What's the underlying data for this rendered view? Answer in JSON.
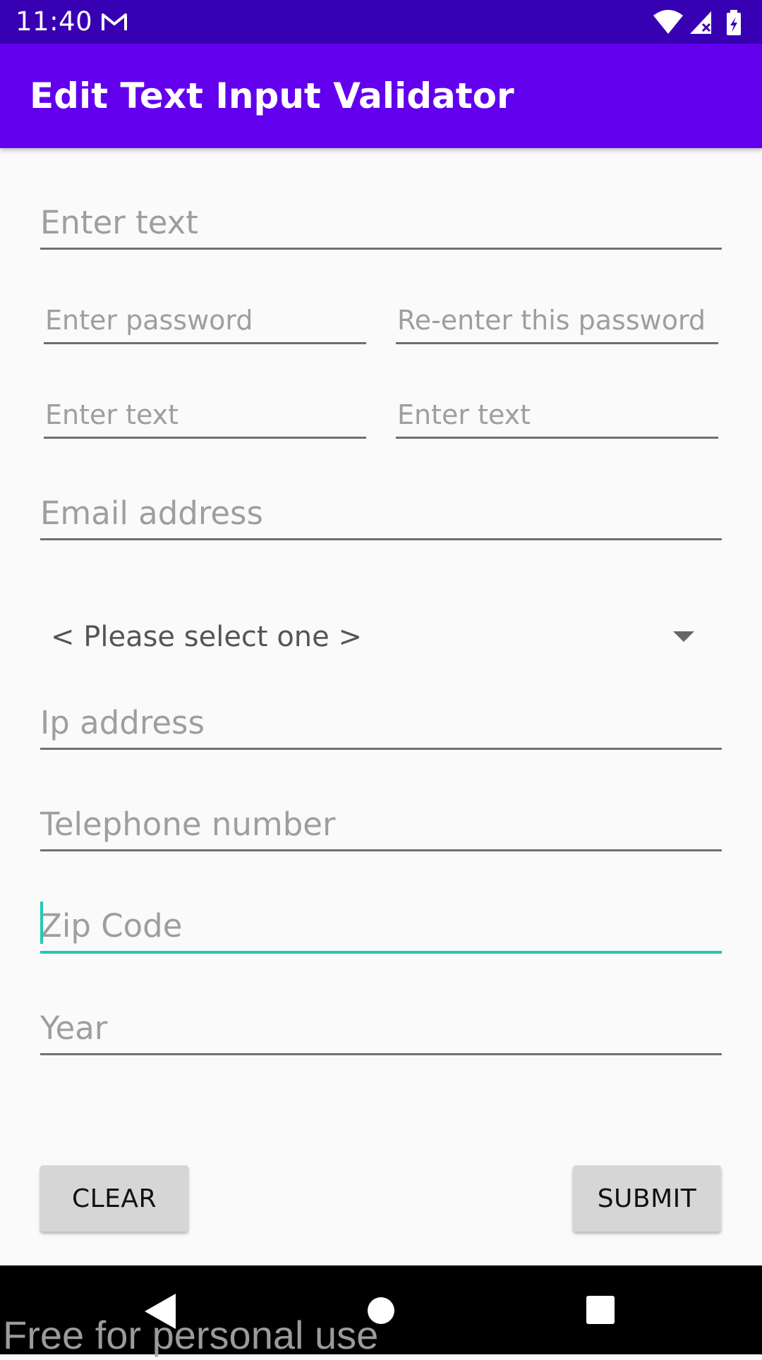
{
  "status_bar": {
    "time": "11:40",
    "icons": [
      "gmail-icon",
      "wifi-icon",
      "signal-icon",
      "battery-charging-icon"
    ]
  },
  "app_bar": {
    "title": "Edit Text Input Validator"
  },
  "form": {
    "text_field": {
      "placeholder": "Enter text",
      "value": ""
    },
    "password_field": {
      "placeholder": "Enter password",
      "value": ""
    },
    "password_confirm_field": {
      "placeholder": "Re-enter this password",
      "value": ""
    },
    "text_field_left": {
      "placeholder": "Enter text",
      "value": ""
    },
    "text_field_right": {
      "placeholder": "Enter text",
      "value": ""
    },
    "email_field": {
      "placeholder": "Email address",
      "value": ""
    },
    "spinner": {
      "selected": "< Please select one >"
    },
    "ip_field": {
      "placeholder": "Ip address",
      "value": ""
    },
    "phone_field": {
      "placeholder": "Telephone number",
      "value": ""
    },
    "zip_field": {
      "placeholder": "Zip Code",
      "value": "",
      "focused": true
    },
    "year_field": {
      "placeholder": "Year",
      "value": ""
    }
  },
  "buttons": {
    "clear_label": "CLEAR",
    "submit_label": "SUBMIT"
  },
  "colors": {
    "status_bar": "#3700b3",
    "app_bar": "#6200ee",
    "focus_accent": "#20c9b4",
    "background": "#fafafa",
    "button": "#d6d6d6"
  },
  "nav_bar": {
    "icons": [
      "back-icon",
      "home-icon",
      "recents-icon"
    ]
  },
  "watermark": "Free for personal use"
}
